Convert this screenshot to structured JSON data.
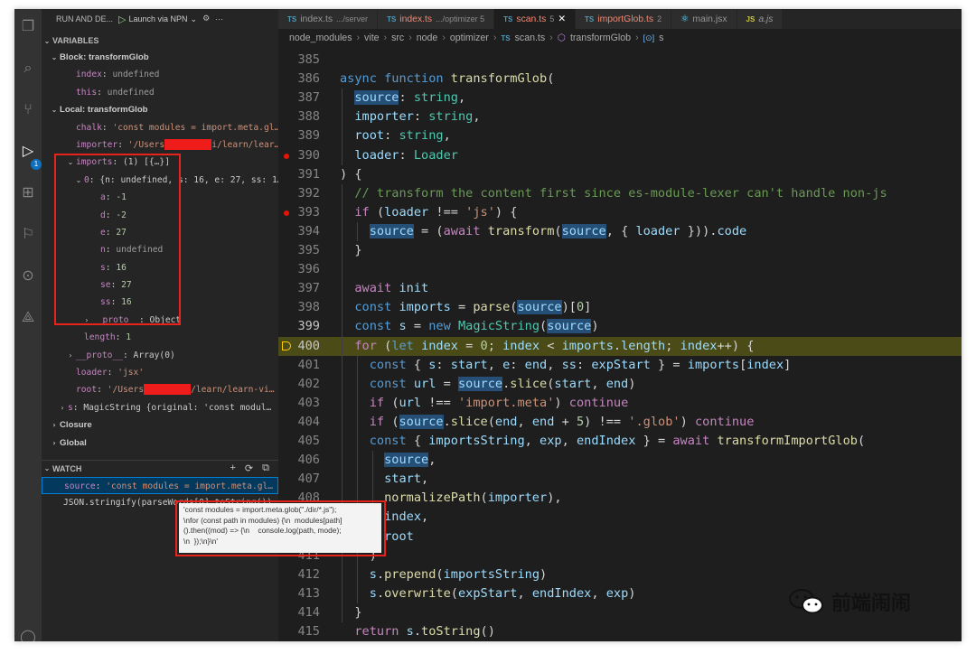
{
  "run_bar": {
    "title": "RUN AND DE...",
    "config": "Launch via NPN"
  },
  "activity_badge": "1",
  "variables": {
    "header": "VARIABLES",
    "rows": [
      {
        "indent": 0,
        "twisty": "v",
        "text": "Block: transformGlob",
        "kind": "scope"
      },
      {
        "indent": 2,
        "twisty": "",
        "name": "index",
        "value": "undefined",
        "vclass": "u"
      },
      {
        "indent": 2,
        "twisty": "",
        "name": "this",
        "value": "undefined",
        "vclass": "u"
      },
      {
        "indent": 0,
        "twisty": "v",
        "text": "Local: transformGlob",
        "kind": "scope"
      },
      {
        "indent": 2,
        "twisty": "",
        "name": "chalk",
        "value": "'const modules = import.meta.gl…",
        "vclass": "s"
      },
      {
        "indent": 2,
        "twisty": "",
        "name": "importer",
        "value": "'/Users",
        "value2": "i/learn/lear…",
        "vclass": "s",
        "redacted": true
      },
      {
        "indent": 2,
        "twisty": "v",
        "name": "imports",
        "value": "(1) [{…}]",
        "vclass": "p"
      },
      {
        "indent": 3,
        "twisty": "v",
        "name": "0",
        "value": "{n: undefined, s: 16, e: 27, ss: 1…",
        "vclass": "p"
      },
      {
        "indent": 5,
        "twisty": "",
        "name": "a",
        "value": "-1",
        "vclass": "n"
      },
      {
        "indent": 5,
        "twisty": "",
        "name": "d",
        "value": "-2",
        "vclass": "n"
      },
      {
        "indent": 5,
        "twisty": "",
        "name": "e",
        "value": "27",
        "vclass": "n"
      },
      {
        "indent": 5,
        "twisty": "",
        "name": "n",
        "value": "undefined",
        "vclass": "u"
      },
      {
        "indent": 5,
        "twisty": "",
        "name": "s",
        "value": "16",
        "vclass": "n"
      },
      {
        "indent": 5,
        "twisty": "",
        "name": "se",
        "value": "27",
        "vclass": "n"
      },
      {
        "indent": 5,
        "twisty": "",
        "name": "ss",
        "value": "16",
        "vclass": "n"
      },
      {
        "indent": 4,
        "twisty": ">",
        "name": "__proto__",
        "value": "Object",
        "vclass": "p"
      },
      {
        "indent": 3,
        "twisty": "",
        "name": "length",
        "value": "1",
        "vclass": "n"
      },
      {
        "indent": 2,
        "twisty": ">",
        "name": "__proto__",
        "value": "Array(0)",
        "vclass": "p"
      },
      {
        "indent": 2,
        "twisty": "",
        "name": "loader",
        "value": "'jsx'",
        "vclass": "s"
      },
      {
        "indent": 2,
        "twisty": "",
        "name": "root",
        "value": "'/Users",
        "value2": "/learn/learn-vi…",
        "vclass": "s",
        "redacted": true
      },
      {
        "indent": 1,
        "twisty": ">",
        "name": "s",
        "value": "MagicString {original: 'const modul…",
        "vclass": "p"
      },
      {
        "indent": 0,
        "twisty": ">",
        "text": "Closure",
        "kind": "scope"
      },
      {
        "indent": 0,
        "twisty": ">",
        "text": "Global",
        "kind": "scope"
      }
    ]
  },
  "watch": {
    "header": "WATCH",
    "rows": [
      {
        "name": "source",
        "value": "'const modules = import.meta.gl…"
      },
      {
        "name": "JSON.stringify(parseWords[0].toString())",
        "value": ""
      }
    ]
  },
  "tooltip": "'const modules = import.meta.glob(\"./dir/*.js\");\n\\nfor (const path in modules) {\\n  modules[path]\n().then((mod) => {\\n    console.log(path, mode);\n\\n  });\\n}\\n'",
  "tabs": [
    {
      "icon": "TS",
      "label": "index.ts",
      "sub": ".../server",
      "err": "",
      "active": false
    },
    {
      "icon": "TS",
      "label": "index.ts",
      "sub": ".../optimizer 5",
      "err": "red",
      "active": false
    },
    {
      "icon": "TS",
      "label": "scan.ts",
      "sub": "5",
      "err": "red",
      "active": true
    },
    {
      "icon": "TS",
      "label": "importGlob.ts",
      "sub": "2",
      "err": "red",
      "active": false
    },
    {
      "icon": "REACT",
      "label": "main.jsx",
      "sub": "",
      "err": "",
      "active": false
    },
    {
      "icon": "JS",
      "label": "a.js",
      "sub": "",
      "err": "",
      "active": false
    }
  ],
  "breadcrumbs": [
    "node_modules",
    "vite",
    "src",
    "node",
    "optimizer",
    "scan.ts",
    "transformGlob",
    "s"
  ],
  "code": {
    "exec_line": 400,
    "current_line": 399,
    "breakpoints": [
      390,
      393
    ],
    "lines": [
      {
        "n": 385,
        "t": ""
      },
      {
        "n": 386,
        "t": "async function transformGlob("
      },
      {
        "n": 387,
        "t": "  source: string,"
      },
      {
        "n": 388,
        "t": "  importer: string,"
      },
      {
        "n": 389,
        "t": "  root: string,"
      },
      {
        "n": 390,
        "t": "  loader: Loader"
      },
      {
        "n": 391,
        "t": ") {"
      },
      {
        "n": 392,
        "t": "  // transform the content first since es-module-lexer can't handle non-js"
      },
      {
        "n": 393,
        "t": "  if (loader !== 'js') {"
      },
      {
        "n": 394,
        "t": "    source = (await transform(source, { loader })).code"
      },
      {
        "n": 395,
        "t": "  }"
      },
      {
        "n": 396,
        "t": ""
      },
      {
        "n": 397,
        "t": "  await init"
      },
      {
        "n": 398,
        "t": "  const imports = parse(source)[0]"
      },
      {
        "n": 399,
        "t": "  const s = new MagicString(source)"
      },
      {
        "n": 400,
        "t": "  for (let index = 0; index < imports.length; index++) {"
      },
      {
        "n": 401,
        "t": "    const { s: start, e: end, ss: expStart } = imports[index]"
      },
      {
        "n": 402,
        "t": "    const url = source.slice(start, end)"
      },
      {
        "n": 403,
        "t": "    if (url !== 'import.meta') continue"
      },
      {
        "n": 404,
        "t": "    if (source.slice(end, end + 5) !== '.glob') continue"
      },
      {
        "n": 405,
        "t": "    const { importsString, exp, endIndex } = await transformImportGlob("
      },
      {
        "n": 406,
        "t": "      source,"
      },
      {
        "n": 407,
        "t": "      start,"
      },
      {
        "n": 408,
        "t": "      normalizePath(importer),"
      },
      {
        "n": 409,
        "t": "      index,"
      },
      {
        "n": 410,
        "t": "      root"
      },
      {
        "n": 411,
        "t": "    )"
      },
      {
        "n": 412,
        "t": "    s.prepend(importsString)"
      },
      {
        "n": 413,
        "t": "    s.overwrite(expStart, endIndex, exp)"
      },
      {
        "n": 414,
        "t": "  }"
      },
      {
        "n": 415,
        "t": "  return s.toString()"
      }
    ]
  },
  "watermark": "前端闹闹",
  "colors": {
    "accent": "#007acc",
    "highlight_box": "#e8231b",
    "exec_line": "#4b4b18",
    "breakpoint": "#e51400"
  }
}
